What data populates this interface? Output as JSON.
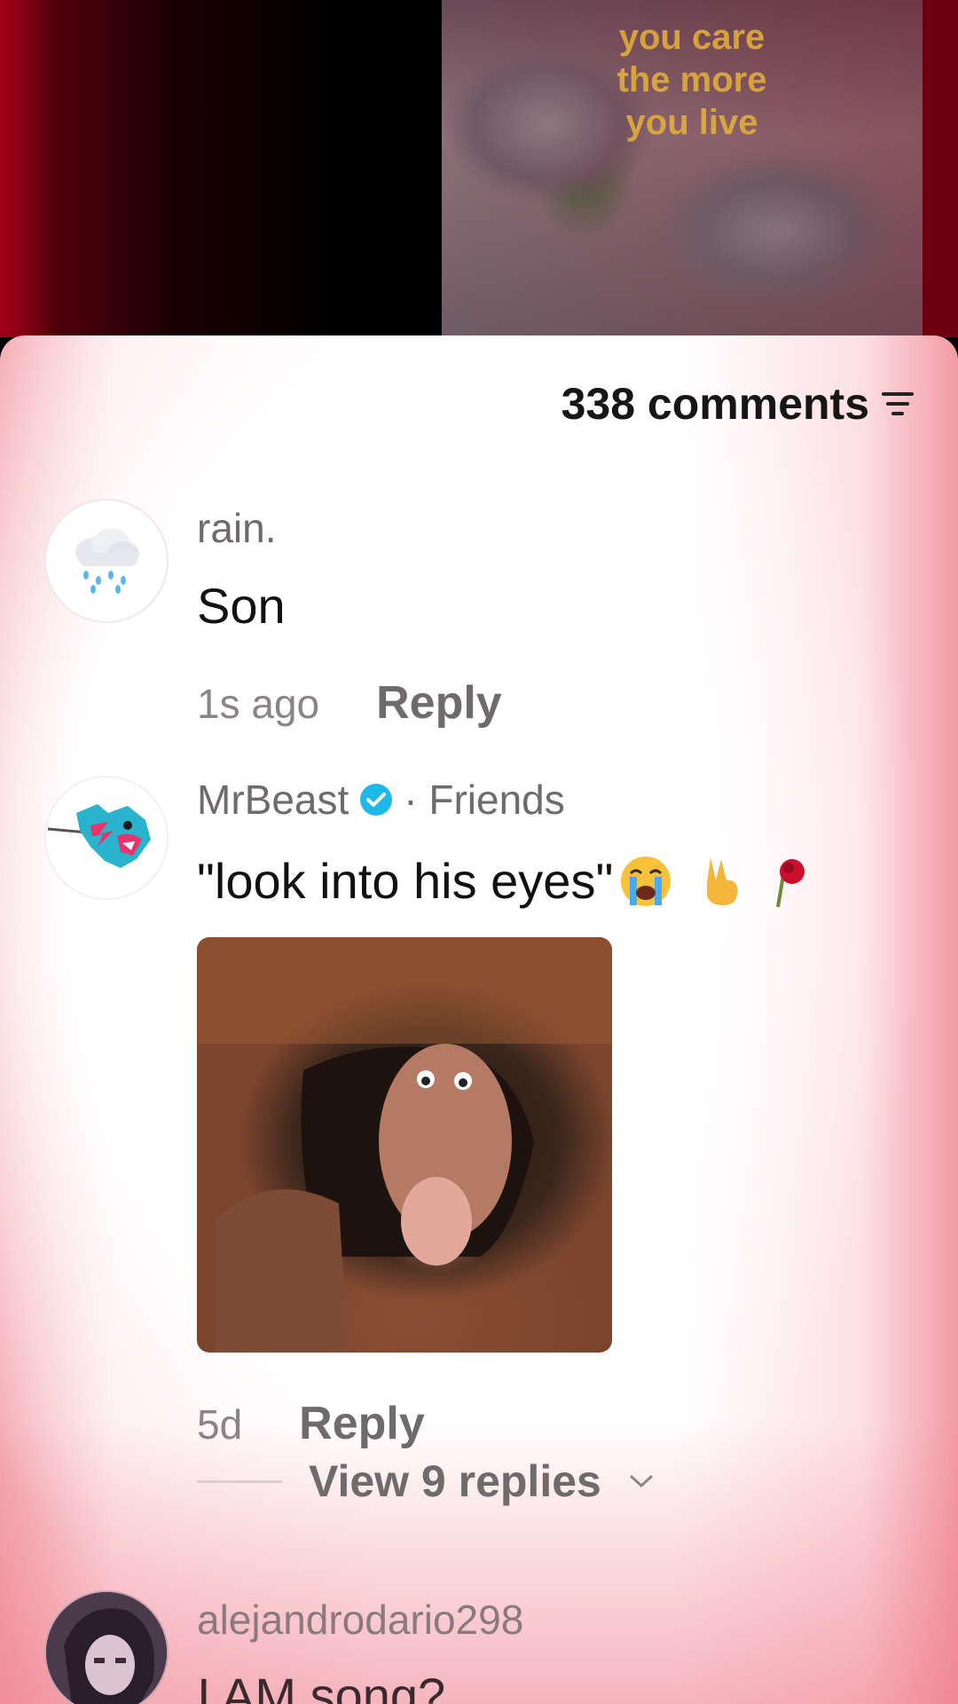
{
  "video": {
    "caption_line1": "you care",
    "caption_line2": "the more",
    "caption_line3": "you live"
  },
  "sheet": {
    "comments_count": "338 comments"
  },
  "comments": [
    {
      "username": "rain.",
      "avatar_icon": "rain-cloud-icon",
      "text": "Son",
      "time": "1s ago",
      "reply_label": "Reply"
    },
    {
      "username": "MrBeast",
      "verified": true,
      "friends_label": "· Friends",
      "avatar_icon": "mrbeast-logo-icon",
      "text": "\"look into his eyes\"",
      "emojis": [
        "crying-face",
        "victory-hand",
        "rose"
      ],
      "time": "5d",
      "reply_label": "Reply",
      "view_replies_label": "View 9 replies"
    },
    {
      "username": "alejandrodario298",
      "text": "I AM song?"
    }
  ],
  "colors": {
    "verified": "#20b8e8",
    "accent_red": "#a0001a"
  }
}
